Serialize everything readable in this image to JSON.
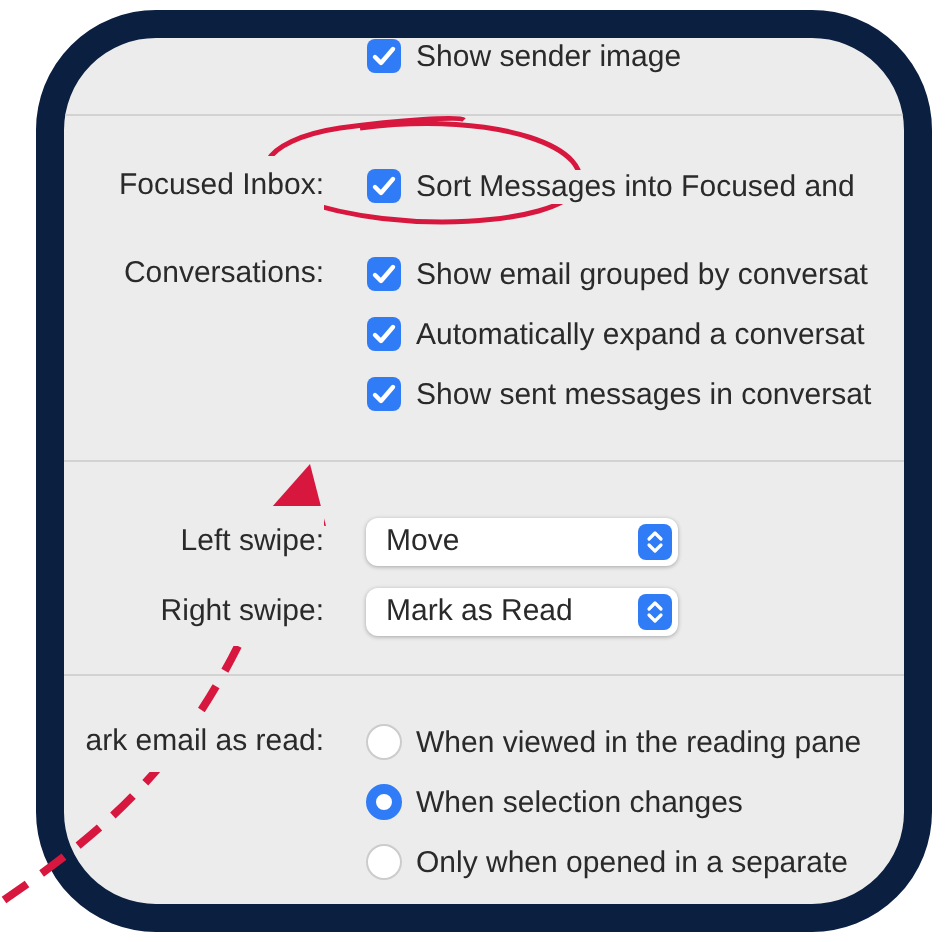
{
  "sender_image": {
    "label": "Show sender image",
    "checked": true
  },
  "focused_inbox": {
    "label": "Focused Inbox:",
    "options": [
      {
        "label": "Sort Messages into Focused and",
        "checked": true
      }
    ]
  },
  "conversations": {
    "label": "Conversations:",
    "options": [
      {
        "label": "Show email grouped by conversat",
        "checked": true
      },
      {
        "label": "Automatically expand a conversat",
        "checked": true
      },
      {
        "label": "Show sent messages in conversat",
        "checked": true
      }
    ]
  },
  "swipes": [
    {
      "label": "Left swipe:",
      "value": "Move"
    },
    {
      "label": "Right swipe:",
      "value": "Mark as Read"
    }
  ],
  "mark_as_read": {
    "label": "ark email as read:",
    "options": [
      {
        "label": "When viewed in the reading pane",
        "selected": false
      },
      {
        "label": "When selection changes",
        "selected": true
      },
      {
        "label": "Only when opened in a separate",
        "selected": false
      }
    ]
  }
}
